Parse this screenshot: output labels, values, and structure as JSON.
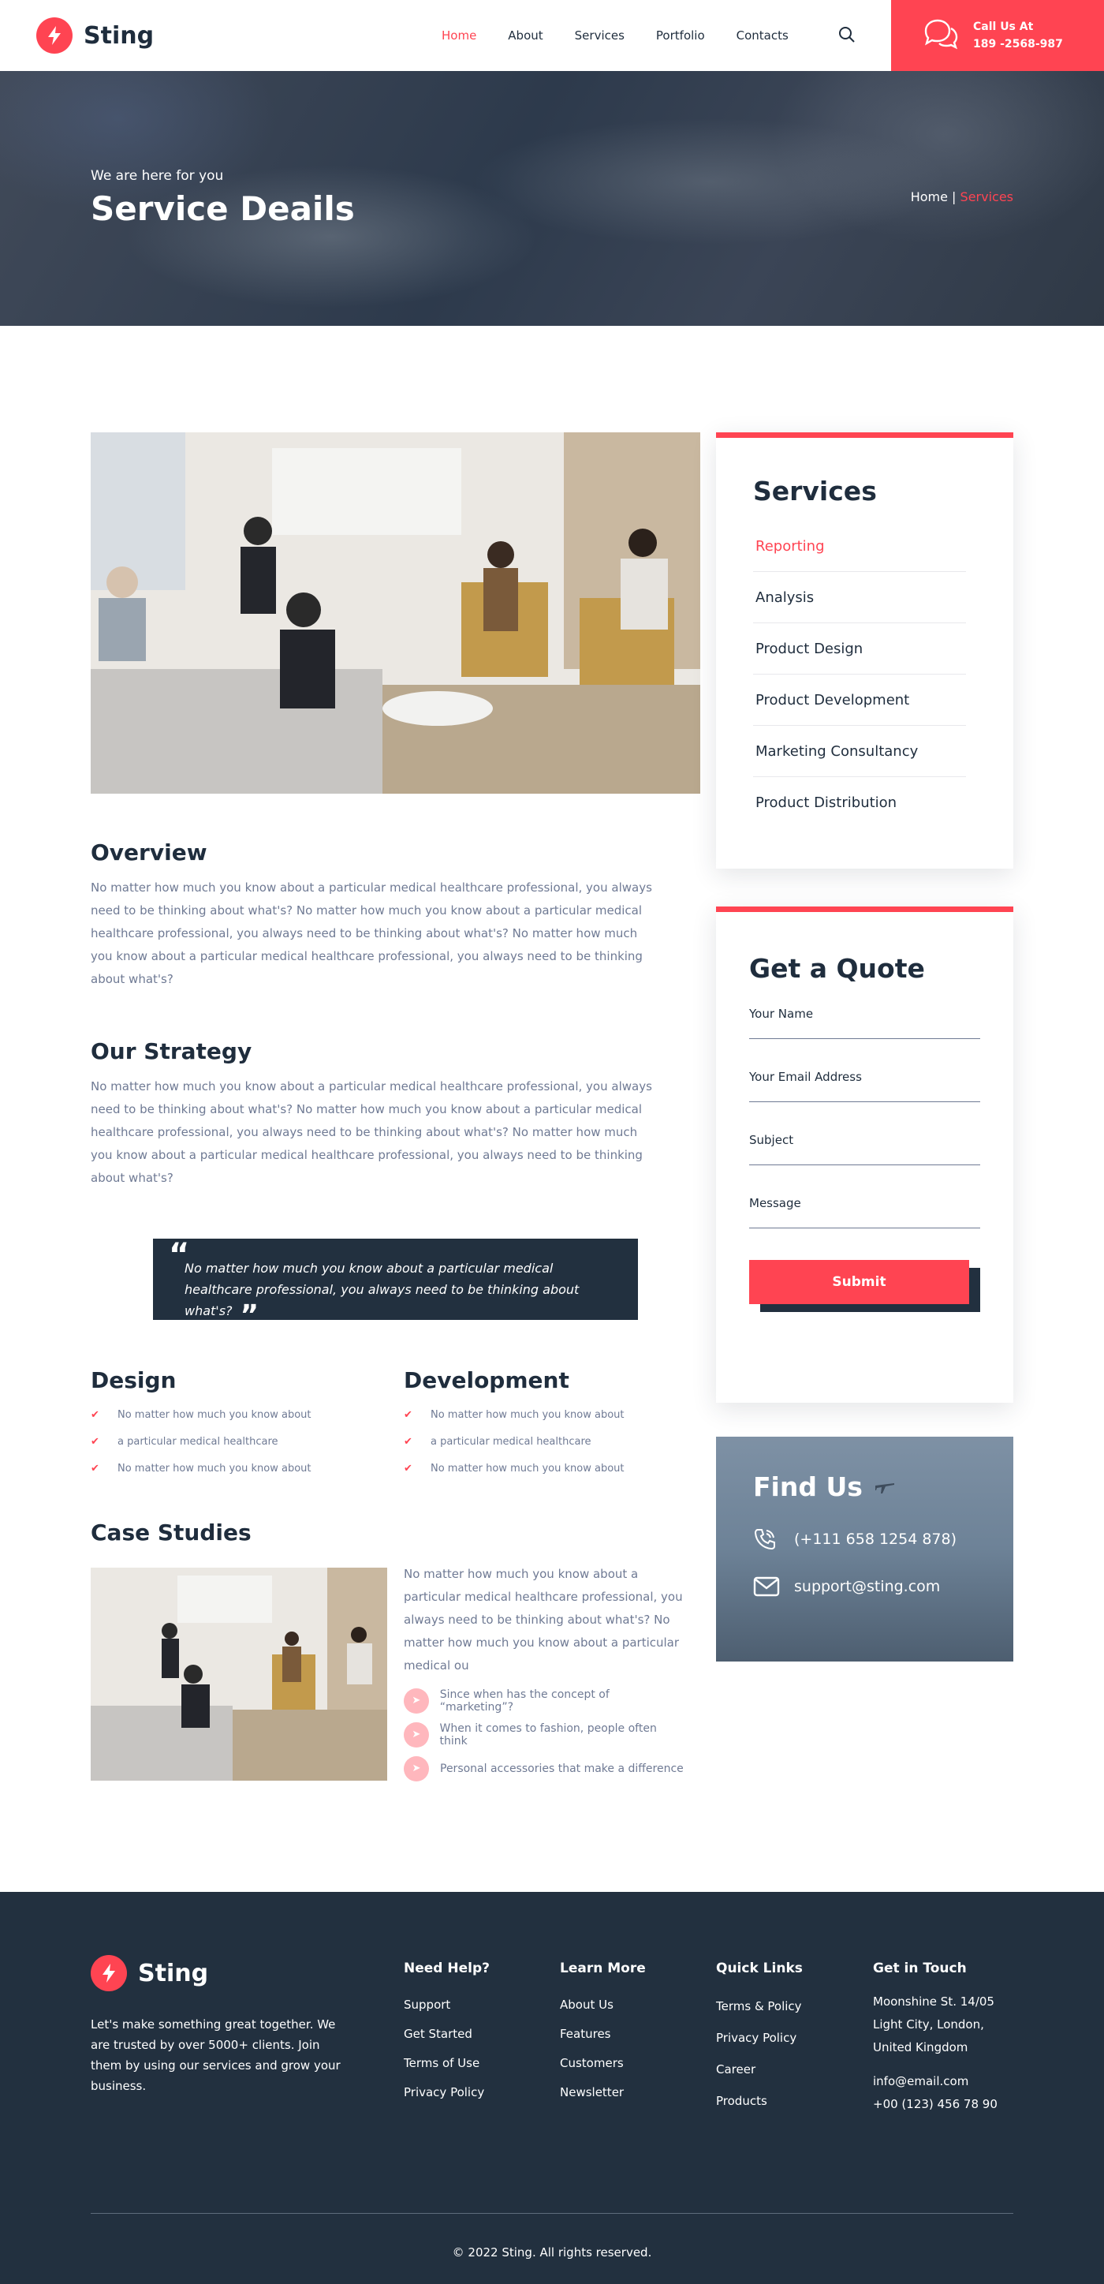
{
  "brand": {
    "name": "Sting",
    "accent": "#ff4452",
    "dark": "#22303f"
  },
  "nav": {
    "items": [
      {
        "label": "Home",
        "active": true
      },
      {
        "label": "About"
      },
      {
        "label": "Services"
      },
      {
        "label": "Portfolio"
      },
      {
        "label": "Contacts"
      }
    ],
    "search_icon": "search-icon"
  },
  "call": {
    "title": "Call Us At",
    "phone": "189 -2568-987",
    "icon": "chat-bubbles-icon"
  },
  "hero": {
    "subtitle": "We are here for you",
    "title": "Service Deails",
    "breadcrumb": {
      "home": "Home",
      "separator": "|",
      "current": "Services"
    }
  },
  "overview": {
    "title": "Overview",
    "text": "No matter how much you know about a particular medical healthcare professional, you always need to be thinking about what's? No matter how much you know about a particular medical healthcare professional, you always need to be thinking about what's? No matter how much you know about a particular medical healthcare professional, you always need to be thinking about what's?"
  },
  "strategy": {
    "title": "Our Strategy",
    "text": "No matter how much you know about a particular medical healthcare professional, you always need to be thinking about what's? No matter how much you know about a particular medical healthcare professional, you always need to be thinking about what's? No matter how much you know about a particular medical healthcare professional, you always need to be thinking about what's?"
  },
  "quote": {
    "text": "No matter how much you know about a particular medical healthcare professional, you always need to be thinking about what's?"
  },
  "design": {
    "title": "Design",
    "items": [
      "No matter how much you know about",
      "a particular medical healthcare",
      "No matter how much you know about"
    ]
  },
  "development": {
    "title": "Development",
    "items": [
      "No matter how much you know about",
      "a particular medical healthcare",
      "No matter how much you know about"
    ]
  },
  "case_studies": {
    "title": "Case Studies",
    "text": "No matter how much you know about a particular medical healthcare professional, you always need to be thinking about what's? No matter how much you know about a particular medical ou",
    "items": [
      "Since when has the concept of “marketing”?",
      "When it comes to fashion, people often think",
      "Personal accessories that make a difference"
    ]
  },
  "services_sidebar": {
    "title": "Services",
    "items": [
      {
        "label": "Reporting",
        "active": true
      },
      {
        "label": "Analysis"
      },
      {
        "label": "Product Design"
      },
      {
        "label": "Product Development"
      },
      {
        "label": "Marketing Consultancy"
      },
      {
        "label": "Product Distribution"
      }
    ]
  },
  "quote_form": {
    "title": "Get a Quote",
    "fields": [
      {
        "label": "Your Name",
        "placeholder": ""
      },
      {
        "label": "Your Email Address",
        "placeholder": ""
      },
      {
        "label": "Subject",
        "placeholder": ""
      },
      {
        "label": "Message",
        "placeholder": ""
      }
    ],
    "submit": "Submit"
  },
  "find_us": {
    "title": "Find Us",
    "phone": "(+111 658 1254 878)",
    "email": "support@sting.com"
  },
  "footer": {
    "description": "Let's make something great together. We are trusted by over 5000+ clients. Join them by using our services and grow your business.",
    "columns": [
      {
        "title": "Need Help?",
        "links": [
          "Support",
          "Get Started",
          "Terms of Use",
          "Privacy Policy"
        ]
      },
      {
        "title": "Learn More",
        "links": [
          "About Us",
          "Features",
          "Customers",
          "Newsletter"
        ]
      },
      {
        "title": "Quick Links",
        "links": [
          "Terms & Policy",
          "Privacy Policy",
          "Career",
          "Products"
        ]
      }
    ],
    "contact": {
      "title": "Get in Touch",
      "address_lines": [
        "Moonshine St. 14/05",
        "Light City, London,",
        "United Kingdom"
      ],
      "email": "info@email.com",
      "phone": "+00 (123) 456 78 90"
    },
    "copyright": "© 2022 Sting. All rights reserved."
  }
}
